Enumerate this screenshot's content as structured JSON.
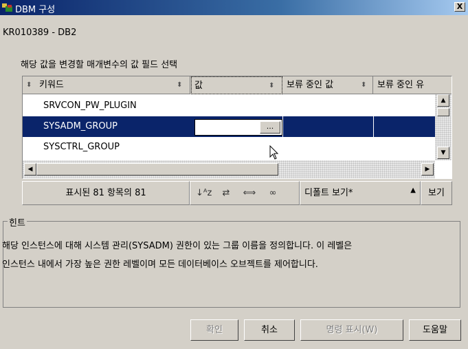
{
  "window": {
    "title": "DBM 구성",
    "close_label": "X"
  },
  "subtitle": "KR010389 - DB2",
  "section_label": "해당 값을 변경할 매개변수의 값 필드 선택",
  "table": {
    "columns": {
      "keyword": "키워드",
      "value": "값",
      "pending": "보류 중인 값",
      "pending2": "보류 중인 유"
    },
    "rows": [
      {
        "keyword": "SRVCON_PW_PLUGIN"
      },
      {
        "keyword": "SYSADM_GROUP",
        "selected": true
      },
      {
        "keyword": "SYSCTRL_GROUP"
      }
    ],
    "edit_button": "..."
  },
  "toolbar": {
    "count_label": "표시된 81 항목의 81",
    "view_select": "디폴트 보기*",
    "view_button": "보기",
    "icons": [
      "sort-az-icon",
      "filter-icon",
      "columns-icon",
      "find-icon"
    ]
  },
  "hint": {
    "title": "힌트",
    "line1": "해당 인스턴스에 대해 시스템 관리(SYSADM) 권한이 있는 그룹 이름을 정의합니다. 이 레벨은",
    "line2": "인스턴스 내에서 가장 높은 권한 레벨이며 모든 데이터베이스 오브젝트를 제어합니다."
  },
  "buttons": {
    "ok": "확인",
    "cancel": "취소",
    "show_command": "명령 표시(W)",
    "help": "도움말"
  }
}
